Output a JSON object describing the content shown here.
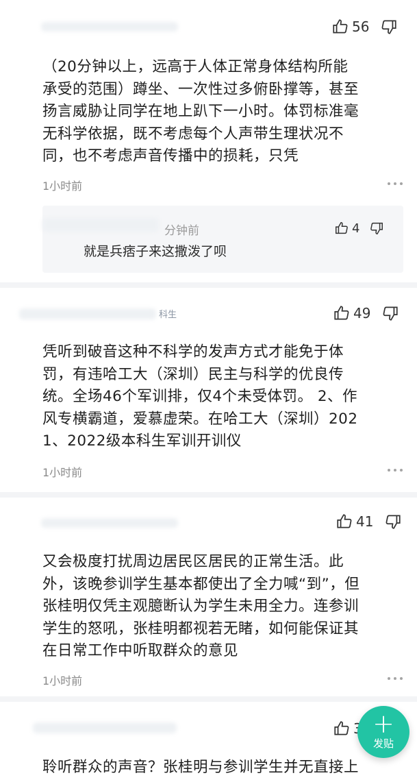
{
  "comments": [
    {
      "tag": "",
      "likes": "56",
      "lines": [
        "（20分钟以上，远高于人体正常身体结构所能",
        "承受的范围）蹲坐、一次性过多俯卧撑等，甚至",
        "扬言威胁让同学在地上趴下一小时。体罚标准毫",
        "无科学依据，既不考虑每个人声带生理状况不",
        "同，也不考虑声音传播中的损耗，只凭"
      ],
      "time": "1小时前",
      "reply": {
        "author_partial": "分钟前",
        "text": "就是兵痞子来这撒泼了呗",
        "likes": "4"
      }
    },
    {
      "tag": "科生",
      "likes": "49",
      "lines": [
        "凭听到破音这种不科学的发声方式才能免于体",
        "罚，有违哈工大（深圳）民主与科学的优良传",
        "统。全场46个军训排，仅4个未受体罚。 2、作",
        "风专横霸道，爱慕虚荣。在哈工大（深圳）202",
        "1、2022级本科生军训开训仪"
      ],
      "time": "1小时前"
    },
    {
      "tag": "",
      "likes": "41",
      "lines": [
        "又会极度打扰周边居民区居民的正常生活。此",
        "外，该晚参训学生基本都使出了全力喊“到”，但",
        "张桂明仅凭主观臆断认为学生未用全力。连参训",
        "学生的怒吼，张桂明都视若无睹，如何能保证其",
        "在日常工作中听取群众的意见"
      ],
      "time": "1小时前"
    },
    {
      "tag": "",
      "likes": "3",
      "lines": [
        "聆听群众的声音？张桂明与参训学生并无直接上"
      ]
    }
  ],
  "fab": {
    "label": "发贴",
    "icon": "plus-icon"
  },
  "colors": {
    "accent": "#22c4a4",
    "divider": "#f3f4f6"
  }
}
